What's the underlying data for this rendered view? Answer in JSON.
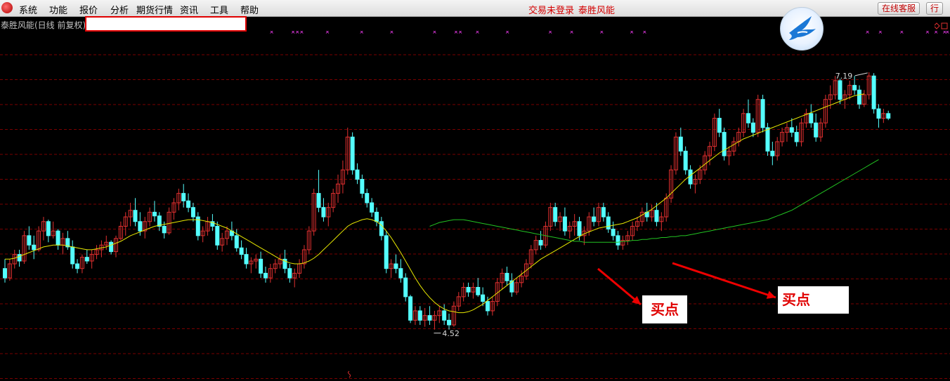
{
  "menu": [
    "系统",
    "功能",
    "报价",
    "分析",
    "期货行情",
    "资讯",
    "工具",
    "帮助"
  ],
  "status": {
    "login": "交易未登录",
    "app": "泰胜风能"
  },
  "buttons": {
    "online_service": "在线客服",
    "row": "行"
  },
  "title": "泰胜风能(日线 前复权)",
  "annotations": {
    "buy1": "买点",
    "buy2": "买点"
  },
  "colors": {
    "up": "#e03030",
    "down": "#54ffff",
    "ma_short": "#e8e800",
    "ma_long": "#22c322",
    "grid": "#7a0000",
    "arrow": "#ee0000",
    "marker": "#ff40ff"
  },
  "chart_data": {
    "type": "candlestick",
    "title": "泰胜风能(日线 前复权)",
    "y_range": [
      4.0,
      7.6
    ],
    "annotations": {
      "high": "7.19",
      "low": "4.52"
    },
    "ohlc": [
      [
        5.1,
        5.2,
        4.95,
        5.0
      ],
      [
        5.0,
        5.2,
        4.97,
        5.15
      ],
      [
        5.15,
        5.3,
        5.1,
        5.25
      ],
      [
        5.25,
        5.3,
        5.12,
        5.18
      ],
      [
        5.18,
        5.5,
        5.15,
        5.45
      ],
      [
        5.45,
        5.55,
        5.3,
        5.35
      ],
      [
        5.35,
        5.45,
        5.2,
        5.3
      ],
      [
        5.3,
        5.55,
        5.28,
        5.5
      ],
      [
        5.5,
        5.65,
        5.4,
        5.6
      ],
      [
        5.6,
        5.62,
        5.38,
        5.45
      ],
      [
        5.45,
        5.6,
        5.42,
        5.5
      ],
      [
        5.5,
        5.52,
        5.3,
        5.35
      ],
      [
        5.35,
        5.48,
        5.25,
        5.42
      ],
      [
        5.42,
        5.5,
        5.3,
        5.33
      ],
      [
        5.33,
        5.4,
        5.1,
        5.15
      ],
      [
        5.15,
        5.2,
        5.05,
        5.1
      ],
      [
        5.1,
        5.25,
        5.05,
        5.22
      ],
      [
        5.22,
        5.3,
        5.15,
        5.18
      ],
      [
        5.18,
        5.3,
        5.1,
        5.25
      ],
      [
        5.25,
        5.35,
        5.2,
        5.3
      ],
      [
        5.3,
        5.4,
        5.22,
        5.35
      ],
      [
        5.35,
        5.45,
        5.3,
        5.38
      ],
      [
        5.38,
        5.4,
        5.25,
        5.28
      ],
      [
        5.28,
        5.45,
        5.22,
        5.42
      ],
      [
        5.42,
        5.6,
        5.4,
        5.55
      ],
      [
        5.55,
        5.7,
        5.45,
        5.65
      ],
      [
        5.65,
        5.8,
        5.55,
        5.72
      ],
      [
        5.72,
        5.85,
        5.55,
        5.6
      ],
      [
        5.6,
        5.7,
        5.45,
        5.5
      ],
      [
        5.5,
        5.65,
        5.42,
        5.6
      ],
      [
        5.6,
        5.75,
        5.55,
        5.7
      ],
      [
        5.7,
        5.82,
        5.6,
        5.66
      ],
      [
        5.66,
        5.7,
        5.5,
        5.55
      ],
      [
        5.55,
        5.6,
        5.42,
        5.48
      ],
      [
        5.48,
        5.75,
        5.46,
        5.7
      ],
      [
        5.7,
        5.85,
        5.62,
        5.8
      ],
      [
        5.8,
        5.95,
        5.72,
        5.9
      ],
      [
        5.9,
        6.0,
        5.75,
        5.82
      ],
      [
        5.82,
        5.9,
        5.7,
        5.75
      ],
      [
        5.75,
        5.8,
        5.6,
        5.65
      ],
      [
        5.65,
        5.7,
        5.4,
        5.45
      ],
      [
        5.45,
        5.55,
        5.38,
        5.5
      ],
      [
        5.5,
        5.65,
        5.45,
        5.6
      ],
      [
        5.6,
        5.68,
        5.5,
        5.55
      ],
      [
        5.55,
        5.6,
        5.3,
        5.35
      ],
      [
        5.35,
        5.48,
        5.28,
        5.42
      ],
      [
        5.42,
        5.55,
        5.35,
        5.5
      ],
      [
        5.5,
        5.6,
        5.4,
        5.45
      ],
      [
        5.45,
        5.52,
        5.28,
        5.32
      ],
      [
        5.32,
        5.4,
        5.2,
        5.25
      ],
      [
        5.25,
        5.32,
        5.1,
        5.15
      ],
      [
        5.15,
        5.22,
        5.05,
        5.18
      ],
      [
        5.18,
        5.25,
        5.1,
        5.2
      ],
      [
        5.2,
        5.28,
        5.0,
        5.05
      ],
      [
        5.05,
        5.12,
        4.95,
        5.0
      ],
      [
        5.0,
        5.15,
        4.95,
        5.1
      ],
      [
        5.1,
        5.2,
        5.05,
        5.15
      ],
      [
        5.15,
        5.25,
        5.1,
        5.2
      ],
      [
        5.2,
        5.3,
        5.05,
        5.1
      ],
      [
        5.1,
        5.15,
        4.95,
        5.0
      ],
      [
        5.0,
        5.1,
        4.9,
        5.05
      ],
      [
        5.05,
        5.2,
        5.0,
        5.15
      ],
      [
        5.15,
        5.35,
        5.1,
        5.3
      ],
      [
        5.3,
        5.55,
        5.25,
        5.5
      ],
      [
        5.5,
        5.95,
        5.45,
        5.9
      ],
      [
        5.9,
        6.15,
        5.7,
        5.75
      ],
      [
        5.75,
        5.85,
        5.6,
        5.65
      ],
      [
        5.65,
        5.8,
        5.55,
        5.75
      ],
      [
        5.75,
        5.95,
        5.7,
        5.9
      ],
      [
        5.9,
        6.1,
        5.8,
        6.0
      ],
      [
        6.0,
        6.25,
        5.9,
        6.15
      ],
      [
        6.15,
        6.6,
        6.1,
        6.5
      ],
      [
        6.5,
        6.55,
        6.1,
        6.15
      ],
      [
        6.15,
        6.22,
        6.0,
        6.05
      ],
      [
        6.05,
        6.1,
        5.85,
        5.9
      ],
      [
        5.9,
        5.95,
        5.75,
        5.8
      ],
      [
        5.8,
        5.85,
        5.65,
        5.7
      ],
      [
        5.7,
        5.75,
        5.55,
        5.6
      ],
      [
        5.6,
        5.65,
        5.4,
        5.45
      ],
      [
        5.45,
        5.5,
        5.05,
        5.1
      ],
      [
        5.1,
        5.2,
        5.0,
        5.15
      ],
      [
        5.15,
        5.25,
        5.05,
        5.1
      ],
      [
        5.1,
        5.2,
        4.95,
        5.0
      ],
      [
        5.0,
        5.05,
        4.75,
        4.8
      ],
      [
        4.8,
        4.82,
        4.52,
        4.55
      ],
      [
        4.55,
        4.7,
        4.5,
        4.65
      ],
      [
        4.65,
        4.7,
        4.5,
        4.55
      ],
      [
        4.55,
        4.68,
        4.48,
        4.6
      ],
      [
        4.6,
        4.7,
        4.5,
        4.55
      ],
      [
        4.55,
        4.65,
        4.45,
        4.6
      ],
      [
        4.6,
        4.7,
        4.52,
        4.65
      ],
      [
        4.65,
        4.72,
        4.5,
        4.55
      ],
      [
        4.55,
        4.62,
        4.45,
        4.5
      ],
      [
        4.5,
        4.75,
        4.48,
        4.7
      ],
      [
        4.7,
        4.85,
        4.65,
        4.8
      ],
      [
        4.8,
        4.95,
        4.75,
        4.9
      ],
      [
        4.9,
        4.95,
        4.8,
        4.85
      ],
      [
        4.85,
        4.95,
        4.78,
        4.9
      ],
      [
        4.9,
        5.0,
        4.8,
        4.82
      ],
      [
        4.82,
        4.9,
        4.7,
        4.75
      ],
      [
        4.75,
        4.8,
        4.6,
        4.65
      ],
      [
        4.65,
        4.8,
        4.6,
        4.75
      ],
      [
        4.75,
        5.0,
        4.7,
        4.95
      ],
      [
        4.95,
        5.1,
        4.88,
        5.05
      ],
      [
        5.05,
        5.12,
        4.92,
        4.97
      ],
      [
        4.97,
        5.05,
        4.8,
        4.85
      ],
      [
        4.85,
        5.0,
        4.82,
        4.95
      ],
      [
        4.95,
        5.08,
        4.9,
        5.02
      ],
      [
        5.02,
        5.2,
        4.98,
        5.15
      ],
      [
        5.15,
        5.35,
        5.1,
        5.3
      ],
      [
        5.3,
        5.45,
        5.25,
        5.4
      ],
      [
        5.4,
        5.5,
        5.3,
        5.35
      ],
      [
        5.35,
        5.6,
        5.32,
        5.55
      ],
      [
        5.55,
        5.8,
        5.5,
        5.75
      ],
      [
        5.75,
        5.8,
        5.55,
        5.6
      ],
      [
        5.6,
        5.7,
        5.5,
        5.65
      ],
      [
        5.65,
        5.75,
        5.45,
        5.5
      ],
      [
        5.5,
        5.6,
        5.42,
        5.55
      ],
      [
        5.55,
        5.68,
        5.45,
        5.6
      ],
      [
        5.6,
        5.65,
        5.4,
        5.45
      ],
      [
        5.45,
        5.55,
        5.35,
        5.5
      ],
      [
        5.5,
        5.7,
        5.45,
        5.65
      ],
      [
        5.65,
        5.75,
        5.55,
        5.6
      ],
      [
        5.6,
        5.8,
        5.55,
        5.75
      ],
      [
        5.75,
        5.8,
        5.6,
        5.65
      ],
      [
        5.65,
        5.7,
        5.48,
        5.52
      ],
      [
        5.52,
        5.6,
        5.4,
        5.45
      ],
      [
        5.45,
        5.5,
        5.3,
        5.35
      ],
      [
        5.35,
        5.45,
        5.3,
        5.4
      ],
      [
        5.4,
        5.5,
        5.35,
        5.45
      ],
      [
        5.45,
        5.6,
        5.4,
        5.55
      ],
      [
        5.55,
        5.65,
        5.5,
        5.6
      ],
      [
        5.6,
        5.75,
        5.55,
        5.7
      ],
      [
        5.7,
        5.8,
        5.6,
        5.65
      ],
      [
        5.65,
        5.78,
        5.6,
        5.72
      ],
      [
        5.72,
        5.8,
        5.55,
        5.6
      ],
      [
        5.6,
        5.7,
        5.5,
        5.65
      ],
      [
        5.65,
        5.9,
        5.6,
        5.85
      ],
      [
        5.85,
        6.2,
        5.8,
        6.15
      ],
      [
        6.15,
        6.55,
        6.1,
        6.5
      ],
      [
        6.5,
        6.6,
        6.3,
        6.35
      ],
      [
        6.35,
        6.4,
        6.1,
        6.15
      ],
      [
        6.15,
        6.2,
        5.95,
        6.0
      ],
      [
        6.0,
        6.1,
        5.9,
        6.05
      ],
      [
        6.05,
        6.2,
        6.0,
        6.15
      ],
      [
        6.15,
        6.35,
        6.1,
        6.3
      ],
      [
        6.3,
        6.45,
        6.2,
        6.4
      ],
      [
        6.4,
        6.75,
        6.35,
        6.7
      ],
      [
        6.7,
        6.8,
        6.5,
        6.55
      ],
      [
        6.55,
        6.6,
        6.25,
        6.3
      ],
      [
        6.3,
        6.4,
        6.2,
        6.35
      ],
      [
        6.35,
        6.5,
        6.3,
        6.45
      ],
      [
        6.45,
        6.6,
        6.4,
        6.55
      ],
      [
        6.55,
        6.8,
        6.5,
        6.75
      ],
      [
        6.75,
        6.9,
        6.6,
        6.65
      ],
      [
        6.65,
        6.7,
        6.5,
        6.55
      ],
      [
        6.55,
        6.95,
        6.5,
        6.9
      ],
      [
        6.9,
        6.95,
        6.55,
        6.6
      ],
      [
        6.6,
        6.65,
        6.3,
        6.35
      ],
      [
        6.35,
        6.45,
        6.2,
        6.3
      ],
      [
        6.3,
        6.5,
        6.25,
        6.45
      ],
      [
        6.45,
        6.6,
        6.4,
        6.55
      ],
      [
        6.55,
        6.65,
        6.45,
        6.6
      ],
      [
        6.6,
        6.7,
        6.5,
        6.55
      ],
      [
        6.55,
        6.62,
        6.4,
        6.45
      ],
      [
        6.45,
        6.7,
        6.4,
        6.65
      ],
      [
        6.65,
        6.8,
        6.6,
        6.75
      ],
      [
        6.75,
        6.85,
        6.6,
        6.65
      ],
      [
        6.65,
        6.75,
        6.45,
        6.5
      ],
      [
        6.5,
        6.7,
        6.45,
        6.65
      ],
      [
        6.65,
        6.95,
        6.6,
        6.9
      ],
      [
        6.9,
        7.05,
        6.8,
        6.95
      ],
      [
        6.95,
        7.15,
        6.9,
        7.1
      ],
      [
        7.1,
        7.12,
        6.85,
        6.9
      ],
      [
        6.9,
        7.0,
        6.8,
        6.95
      ],
      [
        6.95,
        7.1,
        6.9,
        7.05
      ],
      [
        7.05,
        7.15,
        6.95,
        7.0
      ],
      [
        7.0,
        7.05,
        6.8,
        6.85
      ],
      [
        6.85,
        7.0,
        6.82,
        6.95
      ],
      [
        6.95,
        7.19,
        6.9,
        7.15
      ],
      [
        7.15,
        7.18,
        6.75,
        6.8
      ],
      [
        6.8,
        6.85,
        6.6,
        6.7
      ],
      [
        6.7,
        6.8,
        6.65,
        6.75
      ],
      [
        6.75,
        6.78,
        6.68,
        6.7
      ]
    ],
    "ma_short": [
      5.2,
      5.2,
      5.21,
      5.23,
      5.25,
      5.27,
      5.29,
      5.31,
      5.33,
      5.34,
      5.35,
      5.35,
      5.35,
      5.34,
      5.33,
      5.32,
      5.31,
      5.3,
      5.3,
      5.31,
      5.32,
      5.33,
      5.35,
      5.37,
      5.39,
      5.42,
      5.45,
      5.47,
      5.49,
      5.51,
      5.53,
      5.55,
      5.56,
      5.57,
      5.58,
      5.59,
      5.6,
      5.61,
      5.62,
      5.62,
      5.62,
      5.61,
      5.6,
      5.59,
      5.57,
      5.55,
      5.53,
      5.5,
      5.47,
      5.44,
      5.41,
      5.38,
      5.35,
      5.32,
      5.29,
      5.26,
      5.23,
      5.2,
      5.18,
      5.16,
      5.15,
      5.15,
      5.16,
      5.18,
      5.21,
      5.25,
      5.3,
      5.35,
      5.4,
      5.45,
      5.5,
      5.55,
      5.58,
      5.6,
      5.62,
      5.63,
      5.62,
      5.6,
      5.56,
      5.5,
      5.43,
      5.35,
      5.27,
      5.18,
      5.09,
      5.0,
      4.92,
      4.85,
      4.79,
      4.74,
      4.7,
      4.67,
      4.65,
      4.64,
      4.63,
      4.63,
      4.64,
      4.66,
      4.69,
      4.72,
      4.76,
      4.8,
      4.84,
      4.88,
      4.92,
      4.96,
      5.0,
      5.04,
      5.08,
      5.12,
      5.16,
      5.2,
      5.23,
      5.26,
      5.29,
      5.32,
      5.35,
      5.38,
      5.41,
      5.44,
      5.47,
      5.49,
      5.51,
      5.53,
      5.54,
      5.55,
      5.56,
      5.57,
      5.58,
      5.6,
      5.62,
      5.64,
      5.67,
      5.7,
      5.73,
      5.77,
      5.81,
      5.85,
      5.9,
      5.95,
      6.0,
      6.05,
      6.09,
      6.13,
      6.17,
      6.21,
      6.25,
      6.29,
      6.33,
      6.36,
      6.39,
      6.42,
      6.45,
      6.48,
      6.5,
      6.52,
      6.54,
      6.56,
      6.58,
      6.6,
      6.62,
      6.64,
      6.66,
      6.68,
      6.7,
      6.72,
      6.74,
      6.76,
      6.78,
      6.8,
      6.82,
      6.84,
      6.86,
      6.88,
      6.9,
      6.92,
      6.94,
      6.95,
      6.96
    ],
    "ma_long_start": 88,
    "ma_long": [
      5.55,
      5.57,
      5.59,
      5.6,
      5.61,
      5.62,
      5.62,
      5.62,
      5.61,
      5.6,
      5.59,
      5.58,
      5.57,
      5.56,
      5.55,
      5.54,
      5.53,
      5.52,
      5.51,
      5.5,
      5.49,
      5.48,
      5.47,
      5.46,
      5.45,
      5.44,
      5.43,
      5.42,
      5.41,
      5.4,
      5.39,
      5.39,
      5.38,
      5.38,
      5.38,
      5.38,
      5.38,
      5.38,
      5.38,
      5.38,
      5.39,
      5.39,
      5.4,
      5.4,
      5.41,
      5.41,
      5.42,
      5.42,
      5.43,
      5.43,
      5.44,
      5.44,
      5.45,
      5.45,
      5.46,
      5.47,
      5.48,
      5.49,
      5.5,
      5.51,
      5.52,
      5.53,
      5.54,
      5.55,
      5.56,
      5.57,
      5.58,
      5.59,
      5.6,
      5.61,
      5.62,
      5.64,
      5.66,
      5.68,
      5.7,
      5.72,
      5.75,
      5.78,
      5.81,
      5.84,
      5.87,
      5.9,
      5.93,
      5.96,
      5.99,
      6.02,
      6.05,
      6.08,
      6.11,
      6.14,
      6.17,
      6.2,
      6.23,
      6.26
    ],
    "buy_points": [
      88,
      99
    ]
  }
}
